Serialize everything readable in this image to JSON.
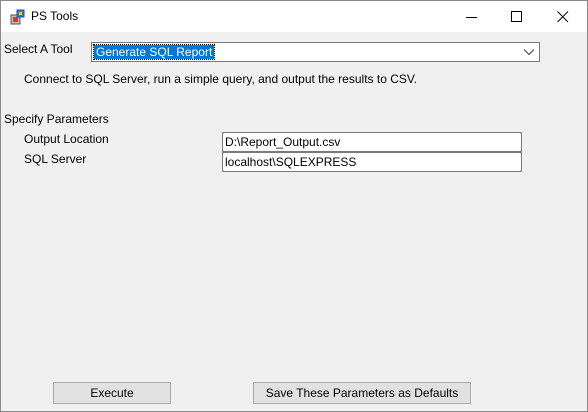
{
  "window": {
    "title": "PS Tools",
    "icon": "ps-tools-app-icon",
    "controls": [
      "minimize-icon",
      "maximize-icon",
      "close-icon"
    ]
  },
  "tool_select": {
    "label": "Select A Tool",
    "value": "Generate SQL Report",
    "description": "Connect to SQL Server, run a simple query, and output the results to CSV."
  },
  "parameters": {
    "heading": "Specify Parameters",
    "fields": [
      {
        "label": "Output Location",
        "value": "D:\\Report_Output.csv"
      },
      {
        "label": "SQL Server",
        "value": "localhost\\SQLEXPRESS"
      }
    ]
  },
  "actions": {
    "execute_label": "Execute",
    "save_defaults_label": "Save These Parameters as Defaults"
  },
  "colors": {
    "selection": "#0078d7",
    "window_bg": "#f0f0f0",
    "button_bg": "#e1e1e1"
  }
}
